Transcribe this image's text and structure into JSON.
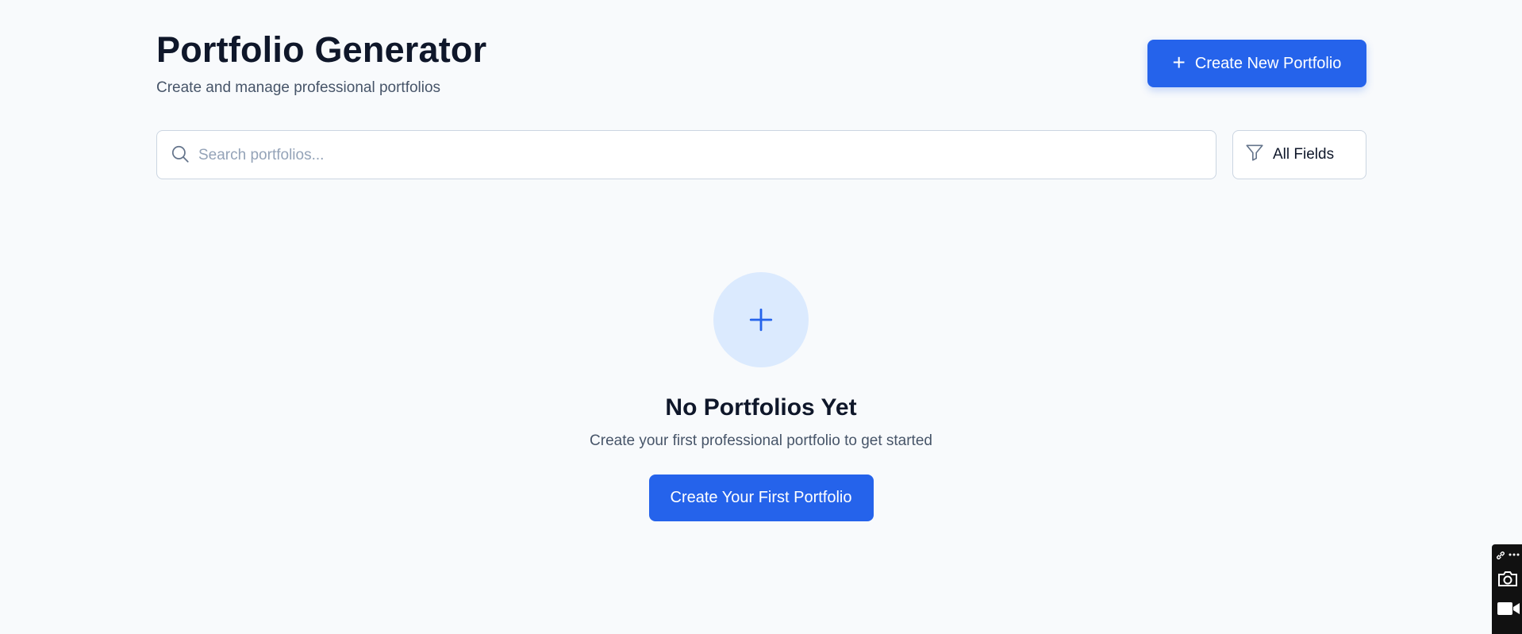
{
  "header": {
    "title": "Portfolio Generator",
    "subtitle": "Create and manage professional portfolios",
    "create_button_label": "Create New Portfolio"
  },
  "search": {
    "placeholder": "Search portfolios...",
    "value": ""
  },
  "filter": {
    "label": "All Fields"
  },
  "empty_state": {
    "title": "No Portfolios Yet",
    "description": "Create your first professional portfolio to get started",
    "button_label": "Create Your First Portfolio"
  },
  "icons": {
    "create_button": "plus-icon",
    "search": "search-icon",
    "filter": "filter-icon",
    "empty_state": "plus-icon",
    "side_widget": [
      "link-icon",
      "more-icon",
      "camera-icon",
      "video-icon"
    ]
  },
  "colors": {
    "accent": "#2563eb",
    "accent_light": "#dbeafe",
    "background": "#f8fafc",
    "text_primary": "#0f172a",
    "text_secondary": "#475569",
    "border": "#cbd5e1"
  }
}
